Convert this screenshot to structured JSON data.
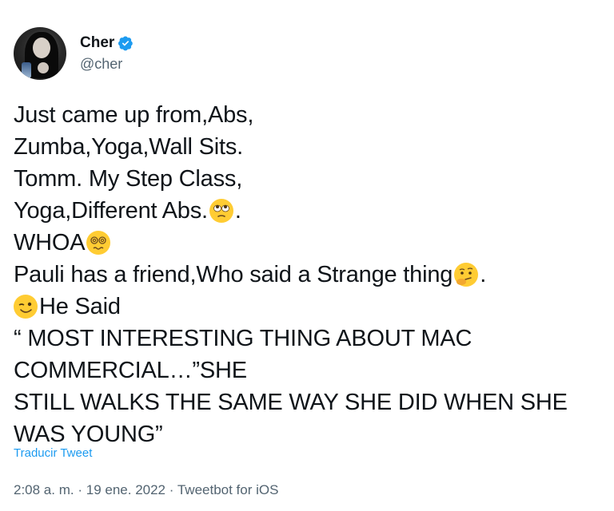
{
  "author": {
    "display_name": "Cher",
    "handle": "@cher",
    "verified": true,
    "avatar_icon": "profile-photo",
    "verified_color": "#1d9bf0"
  },
  "tweet": {
    "lines": [
      "Just came up from,Abs,",
      "Zumba,Yoga,Wall Sits.",
      "Tomm. My Step Class,",
      "Yoga,Different Abs.",
      "WHOA",
      "Pauli has a friend,Who said a Strange thing",
      "He Said",
      "“ MOST INTERESTING THING ABOUT MAC",
      "COMMERCIAL…”SHE",
      "STILL WALKS THE SAME WAY SHE DID WHEN SHE",
      "WAS YOUNG”"
    ],
    "period": ".",
    "emojis": [
      "face-with-rolling-eyes",
      "face-with-spiral-eyes",
      "thinking-face",
      "winking-face"
    ]
  },
  "actions": {
    "translate_label": "Traducir Tweet"
  },
  "meta": {
    "time": "2:08 a. m.",
    "separator": "·",
    "date": "19 ene. 2022",
    "source": "Tweetbot for iOS"
  },
  "colors": {
    "link": "#1d9bf0",
    "secondary_text": "#536471",
    "primary_text": "#0f1419"
  }
}
